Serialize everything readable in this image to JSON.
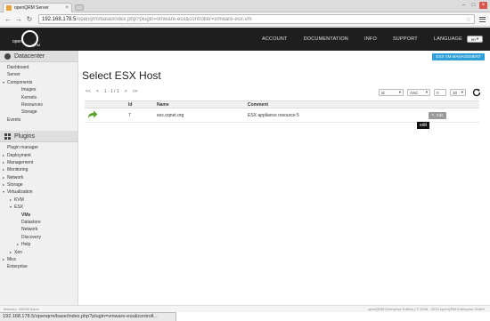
{
  "browser": {
    "tab_title": "openQRM Server",
    "url_host": "192.168.178.5",
    "url_path": "/openqrm/base/index.php?plugin=vmware-esx&controller=vmware-esx-vm",
    "status_url": "192.168.178.5/openqrm/base/index.php?plugin=vmware-esx&controll..."
  },
  "logo": {
    "part1": "open",
    "part2": "QRM",
    "part3": "esx"
  },
  "topnav": {
    "items": [
      "ACCOUNT",
      "DOCUMENTATION",
      "INFO",
      "SUPPORT",
      "LANGUAGE"
    ],
    "lang_value": "en"
  },
  "sidebar": {
    "datacenter_title": "Datacenter",
    "datacenter_items": [
      {
        "label": "Dashboard",
        "indent": 0,
        "tri": ""
      },
      {
        "label": "Server",
        "indent": 0,
        "tri": ""
      },
      {
        "label": "Components",
        "indent": 0,
        "tri": "▾"
      },
      {
        "label": "Images",
        "indent": 2,
        "tri": ""
      },
      {
        "label": "Kernels",
        "indent": 2,
        "tri": ""
      },
      {
        "label": "Resources",
        "indent": 2,
        "tri": ""
      },
      {
        "label": "Storage",
        "indent": 2,
        "tri": ""
      },
      {
        "label": "Events",
        "indent": 0,
        "tri": ""
      }
    ],
    "plugins_title": "Plugins",
    "plugin_items": [
      {
        "label": "Plugin manager",
        "indent": 0,
        "tri": ""
      },
      {
        "label": "Deployment",
        "indent": 0,
        "tri": "▸"
      },
      {
        "label": "Management",
        "indent": 0,
        "tri": "▸"
      },
      {
        "label": "Monitoring",
        "indent": 0,
        "tri": "▸"
      },
      {
        "label": "Network",
        "indent": 0,
        "tri": "▸"
      },
      {
        "label": "Storage",
        "indent": 0,
        "tri": "▸"
      },
      {
        "label": "Virtualization",
        "indent": 0,
        "tri": "▾"
      },
      {
        "label": "KVM",
        "indent": 1,
        "tri": "▸"
      },
      {
        "label": "ESX",
        "indent": 1,
        "tri": "▾"
      },
      {
        "label": "VMs",
        "indent": 2,
        "tri": "",
        "active": true
      },
      {
        "label": "Datastore",
        "indent": 2,
        "tri": ""
      },
      {
        "label": "Network",
        "indent": 2,
        "tri": ""
      },
      {
        "label": "Discovery",
        "indent": 2,
        "tri": ""
      },
      {
        "label": "Help",
        "indent": 2,
        "tri": "▸"
      },
      {
        "label": "Xen",
        "indent": 1,
        "tri": "▸"
      },
      {
        "label": "Misc",
        "indent": 0,
        "tri": "▸"
      },
      {
        "label": "Enterprise",
        "indent": 0,
        "tri": ""
      }
    ]
  },
  "main": {
    "esx_button": "ESX VM MANAGEMENT",
    "title": "Select ESX Host",
    "pager": [
      "<<",
      "<",
      "1 - 1 / 1",
      ">",
      ">>"
    ],
    "sort_field": "id",
    "sort_order": "ASC",
    "offset": "0",
    "limit": "10",
    "columns": [
      "",
      "Id",
      "Name",
      "Comment",
      ""
    ],
    "rows": [
      {
        "id": "7",
        "name": "esx.oqnet.org",
        "comment": "ESX appliance resource 5",
        "action": "Edit"
      }
    ],
    "tooltip": "edit"
  },
  "footer": {
    "memory": "Memory: 4/6090 bytes",
    "copyright": "openQRM Enterprise Edition | © 2006 - 2013 openQRM Enterprise GmbH"
  },
  "colors": {
    "accent": "#2fa0d8",
    "header_bg": "#1f1f1f",
    "edit_icon_green": "#5aa02c"
  }
}
